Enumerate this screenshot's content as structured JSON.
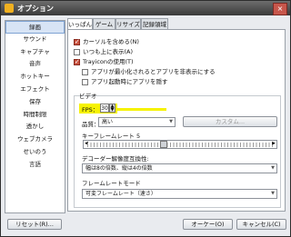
{
  "window": {
    "title": "オプション",
    "close_label": "×"
  },
  "sidebar": {
    "items": [
      {
        "label": "録画"
      },
      {
        "label": "サウンド"
      },
      {
        "label": "キャプチャ"
      },
      {
        "label": "音声"
      },
      {
        "label": "ホットキー"
      },
      {
        "label": "エフェクト"
      },
      {
        "label": "保存"
      },
      {
        "label": "時間制限"
      },
      {
        "label": "透かし"
      },
      {
        "label": "ウェブカメラ"
      },
      {
        "label": "せいのう"
      },
      {
        "label": "言語"
      }
    ],
    "selected_index": 0
  },
  "tabs": [
    {
      "label": "いっぱん",
      "active": true
    },
    {
      "label": "ゲーム",
      "active": false
    },
    {
      "label": "リサイズ",
      "active": false
    },
    {
      "label": "記録領域",
      "active": false
    }
  ],
  "general": {
    "checkboxes": [
      {
        "label": "カーソルを含める(N)",
        "checked": true
      },
      {
        "label": "いつも上に表示(A)",
        "checked": false
      },
      {
        "label": "Trayiconの使用(T)",
        "checked": true
      },
      {
        "label": "アプリが最小化されるとアプリを非表示にする",
        "checked": false
      },
      {
        "label": "アプリ起動時にアプリを隠す",
        "checked": false
      }
    ]
  },
  "video": {
    "group_label": "ビデオ",
    "fps_label": "FPS：",
    "fps_value": "30",
    "quality_label": "品質：",
    "quality_value": "高い",
    "custom_button": "カスタム...",
    "keyframe_label": "キーフレームレート 5",
    "slider_level": 0.4,
    "decoder_label": "デコーダー解像度互換性:",
    "decoder_value": "幅は8の倍数、縦は4の倍数",
    "framemode_label": "フレームレートモード",
    "framemode_value": "可変フレームレート（速さ）"
  },
  "footer": {
    "reset_label": "リセット(R)...",
    "ok_label": "オーケー(O)",
    "cancel_label": "キャンセル(C)"
  },
  "colors": {
    "highlight": "#f6f200",
    "accent": "#c9523f"
  }
}
